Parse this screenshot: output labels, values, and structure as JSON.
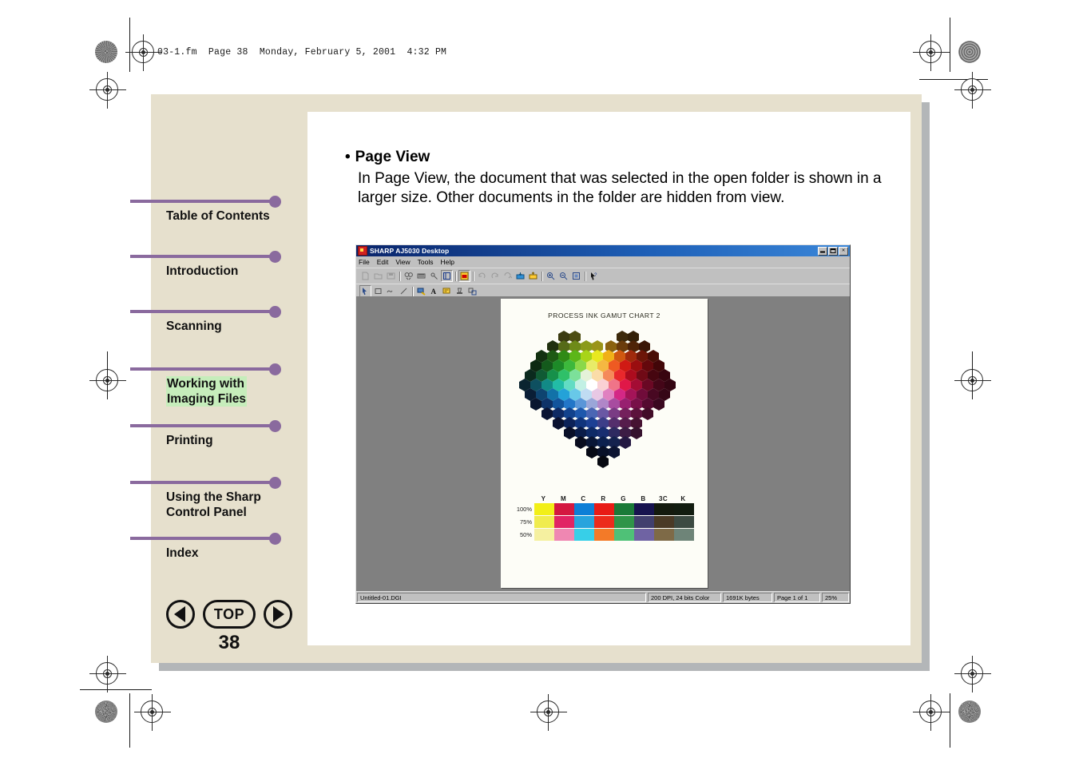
{
  "fm_header": "03-1.fm  Page 38  Monday, February 5, 2001  4:32 PM",
  "sidebar": {
    "items": [
      {
        "label": "Table of Contents",
        "active": false
      },
      {
        "label": "Introduction",
        "active": false
      },
      {
        "label": "Scanning",
        "active": false
      },
      {
        "label": "Working with\nImaging Files",
        "active": true
      },
      {
        "label": "Printing",
        "active": false
      },
      {
        "label": "Using the Sharp\nControl Panel",
        "active": false
      },
      {
        "label": "Index",
        "active": false
      }
    ],
    "accent_color": "#8a6a9e",
    "highlight_color": "#c6edbb"
  },
  "nav_buttons": {
    "previous": "previous-page",
    "top_label": "TOP",
    "next": "next-page",
    "page_number": "38"
  },
  "article": {
    "bullet": "•",
    "heading": "Page View",
    "body": "In Page View, the document that was selected in the open folder is shown in a larger size. Other documents in the folder are hidden from view."
  },
  "app_window": {
    "title": "SHARP AJ5030 Desktop",
    "window_buttons": {
      "minimize": "minimize",
      "restore": "restore",
      "close": "×"
    },
    "menus": [
      "File",
      "Edit",
      "View",
      "Tools",
      "Help"
    ],
    "toolbar_row1": [
      "new-icon",
      "open-icon",
      "save-icon",
      "sep",
      "find-icon",
      "scan-icon",
      "properties-icon",
      "page-view-icon",
      "sep",
      "thumbnail-view-icon",
      "sep",
      "rotate-left-icon",
      "rotate-right-icon",
      "rotate-180-icon",
      "import-icon",
      "export-icon",
      "sep",
      "zoom-in-icon",
      "zoom-out-icon",
      "fit-page-icon",
      "sep",
      "help-cursor-icon"
    ],
    "toolbar_row2": [
      "select-arrow-icon",
      "rectangle-icon",
      "freehand-icon",
      "line-icon",
      "sep",
      "stamp-icon",
      "text-icon",
      "note-icon",
      "highlight-icon",
      "attach-icon"
    ],
    "document": {
      "title": "PROCESS INK GAMUT CHART 2",
      "swatch_columns": [
        "Y",
        "M",
        "C",
        "R",
        "G",
        "B",
        "3C",
        "K"
      ],
      "swatch_rows": [
        {
          "label": "100%",
          "colors": [
            "#f2ef18",
            "#d41840",
            "#0d7fd6",
            "#e81b15",
            "#1a7a38",
            "#17134f",
            "#141a0e",
            "#121c10"
          ]
        },
        {
          "label": "75%",
          "colors": [
            "#f0ec4e",
            "#e12464",
            "#28a4dd",
            "#ec2b1c",
            "#2f9448",
            "#413f6e",
            "#4a3a26",
            "#3c4a42"
          ]
        },
        {
          "label": "50%",
          "colors": [
            "#f5f0a0",
            "#ef87b2",
            "#37cfe8",
            "#f37a28",
            "#4fc177",
            "#6f63a3",
            "#7e6a47",
            "#6e8478"
          ]
        }
      ]
    },
    "statusbar": {
      "filename": "Untitled-01.DGI",
      "resolution": "200 DPI, 24 bits Color",
      "filesize": "1691K bytes",
      "page": "Page 1 of 1",
      "zoom": "25%"
    },
    "canvas_color": "#808080"
  }
}
